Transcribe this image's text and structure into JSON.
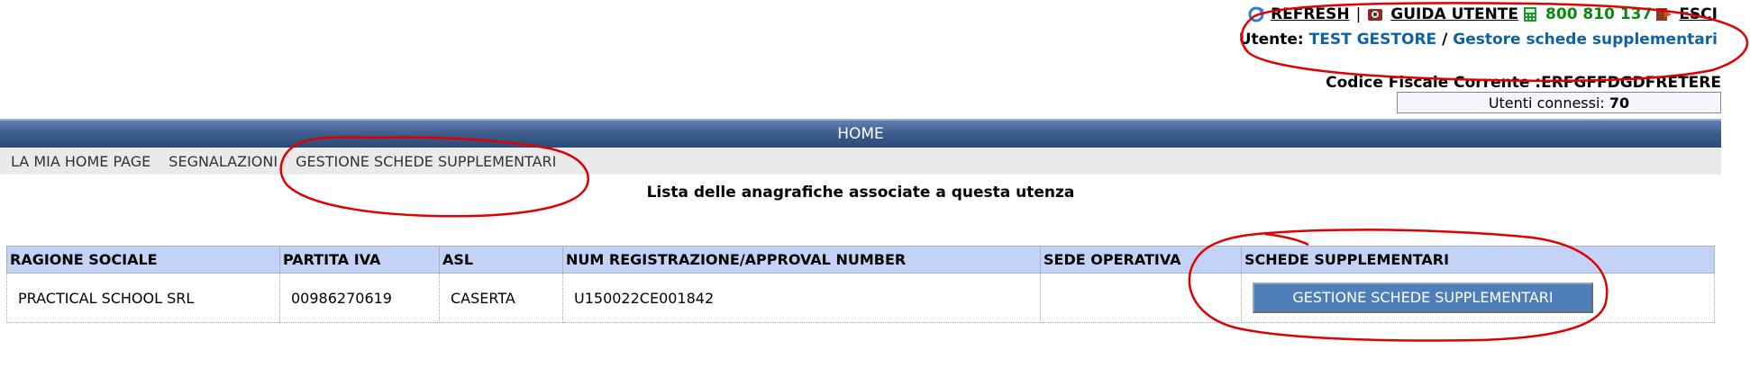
{
  "header": {
    "refresh_label": "REFRESH",
    "separator": "|",
    "guide_label": "GUIDA UTENTE",
    "phone_label": "800 810 137",
    "exit_label": "ESCI",
    "user_prefix": "Utente:",
    "user_name": "TEST GESTORE",
    "user_separator": "/",
    "user_role": "Gestore schede supplementari",
    "fiscal_code_label": "Codice Fiscale Corrente :",
    "fiscal_code_value": "ERFGFFDGDFRETERE",
    "connected_label": "Utenti connessi:",
    "connected_count": "70"
  },
  "nav": {
    "home_label": "HOME",
    "menu": [
      {
        "label": "LA MIA HOME PAGE"
      },
      {
        "label": "SEGNALAZIONI"
      },
      {
        "label": "GESTIONE SCHEDE SUPPLEMENTARI"
      }
    ]
  },
  "main": {
    "title": "Lista delle anagrafiche associate a questa utenza",
    "table": {
      "columns": [
        "RAGIONE SOCIALE",
        "PARTITA IVA",
        "ASL",
        "NUM REGISTRAZIONE/APPROVAL NUMBER",
        "SEDE OPERATIVA",
        "SCHEDE SUPPLEMENTARI"
      ],
      "rows": [
        {
          "ragione_sociale": "PRACTICAL SCHOOL SRL",
          "partita_iva": "00986270619",
          "asl": "CASERTA",
          "num_registrazione": "U150022CE001842",
          "sede_operativa": "",
          "action_label": "GESTIONE SCHEDE SUPPLEMENTARI"
        }
      ]
    }
  },
  "icons": {
    "refresh": "refresh-icon",
    "guide": "guide-icon",
    "phone": "phone-icon",
    "exit": "exit-icon"
  },
  "colors": {
    "home_bar": "#3f5f8f",
    "table_header": "#c3d3f7",
    "action_button": "#4e7fb9",
    "phone_text": "#0b8a10",
    "user_link": "#0f62a8",
    "annotation": "#e00000"
  }
}
